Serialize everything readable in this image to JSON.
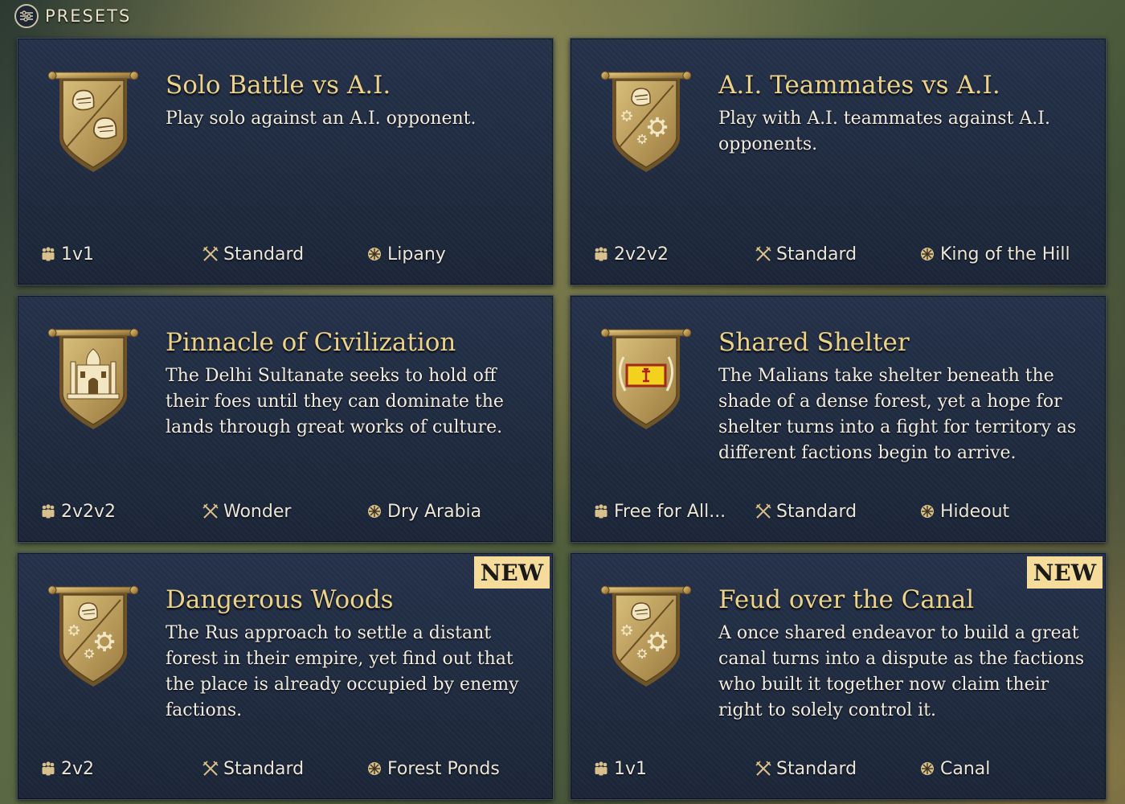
{
  "header": {
    "title": "PRESETS",
    "icon": "presets-icon"
  },
  "colors": {
    "title_gold": "#ecd28a",
    "card_bg": "#1c2638",
    "badge_bg": "#f5dc9a"
  },
  "cards": [
    {
      "title": "Solo Battle vs A.I.",
      "description": "Play solo against an A.I. opponent.",
      "crest": "crest-helmets-icon",
      "players": "1v1",
      "mode": "Standard",
      "map": "Lipany"
    },
    {
      "title": "A.I. Teammates vs A.I.",
      "description": "Play with A.I. teammates against A.I. opponents.",
      "crest": "crest-ai-team-icon",
      "players": "2v2v2",
      "mode": "Standard",
      "map": "King of the Hill"
    },
    {
      "title": "Pinnacle of Civilization",
      "description": "The Delhi Sultanate seeks to hold off their foes until they can dominate the lands through great works of culture.",
      "crest": "crest-palace-icon",
      "players": "2v2v2",
      "mode": "Wonder",
      "map": "Dry Arabia"
    },
    {
      "title": "Shared Shelter",
      "description": "The Malians take shelter beneath the shade of a dense forest, yet a hope for shelter turns into a fight for territory as different factions begin to arrive.",
      "crest": "crest-flag-icon",
      "players": "Free for All...",
      "mode": "Standard",
      "map": "Hideout"
    },
    {
      "title": "Dangerous Woods",
      "description": "The Rus approach to settle a distant forest in their empire, yet find out that the place is already occupied by enemy factions.",
      "crest": "crest-ai-team-icon",
      "players": "2v2",
      "mode": "Standard",
      "map": "Forest Ponds",
      "badge": "NEW"
    },
    {
      "title": "Feud over the Canal",
      "description": "A once shared endeavor to build a great canal turns into a dispute as the factions who built it together now claim their right to solely control it.",
      "crest": "crest-ai-team-icon",
      "players": "1v1",
      "mode": "Standard",
      "map": "Canal",
      "badge": "NEW"
    }
  ]
}
